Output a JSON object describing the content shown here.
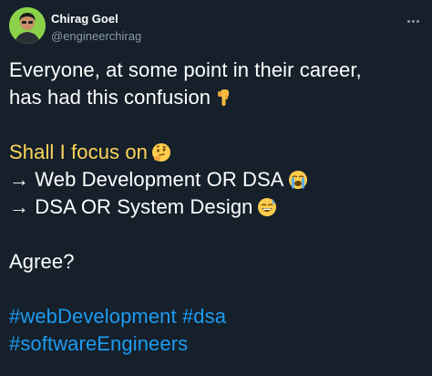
{
  "author": {
    "name": "Chirag Goel",
    "handle": "@engineerchirag"
  },
  "tweet": {
    "line1": "Everyone, at some point in their career,",
    "line2": "has had this confusion",
    "line3": "Shall I focus on",
    "line4": "→ Web Development OR DSA",
    "line5": "→ DSA OR System Design",
    "line6": "Agree?",
    "hashtag1": "#webDevelopment",
    "hashtag2": "#dsa",
    "hashtag3": "#softwareEngineers"
  },
  "icons": {
    "more": "more-options-icon",
    "emoji_pointing_down": "pointing-down-emoji",
    "emoji_thinking": "thinking-face-emoji",
    "emoji_crying": "loudly-crying-face-emoji",
    "emoji_sweat_smile": "grinning-sweat-face-emoji"
  },
  "colors": {
    "background": "#15202b",
    "text": "#ffffff",
    "secondary_text": "#8b98a5",
    "highlight": "#ffd659",
    "link": "#1d9bf0"
  }
}
